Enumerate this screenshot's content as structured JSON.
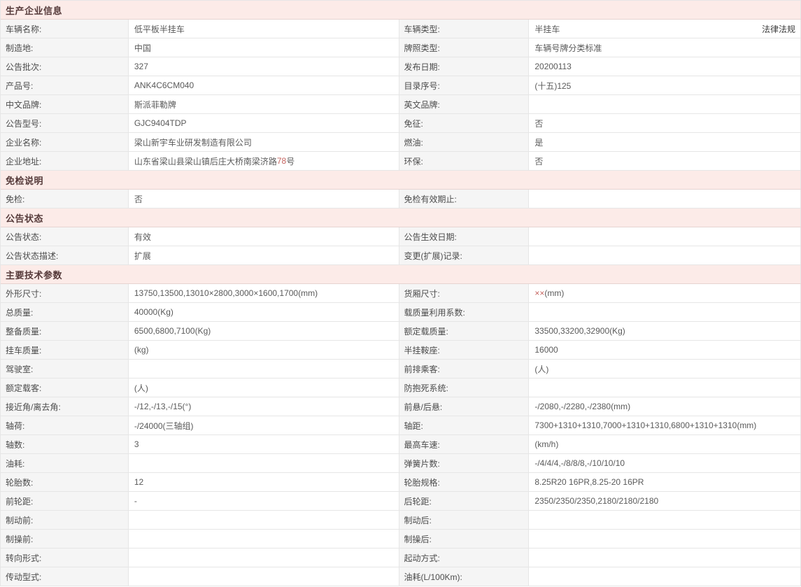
{
  "colors": {
    "section_header_bg": "#fcebe8",
    "section_header_text": "#553a3a",
    "label_cell_bg": "#f5f5f5",
    "value_cell_bg": "#ffffff",
    "highlight_text": "#c5635e",
    "border": "#e6e6e6"
  },
  "sections": [
    {
      "title": "生产企业信息",
      "rows": [
        {
          "left": {
            "label": "车辆名称:",
            "value": "低平板半挂车"
          },
          "right": {
            "label": "车辆类型:",
            "value": "半挂车"
          },
          "extra_link": "法律法规"
        },
        {
          "left": {
            "label": "制造地:",
            "value": "中国"
          },
          "right": {
            "label": "牌照类型:",
            "value": "车辆号牌分类标准"
          }
        },
        {
          "left": {
            "label": "公告批次:",
            "value": "327"
          },
          "right": {
            "label": "发布日期:",
            "value": "20200113"
          }
        },
        {
          "left": {
            "label": "产品号:",
            "value": "ANK4C6CM040"
          },
          "right": {
            "label": "目录序号:",
            "value": "(十五)125"
          }
        },
        {
          "left": {
            "label": "中文品牌:",
            "value": "斯派菲勒牌"
          },
          "right": {
            "label": "英文品牌:",
            "value": ""
          }
        },
        {
          "left": {
            "label": "公告型号:",
            "value": "GJC9404TDP"
          },
          "right": {
            "label": "免征:",
            "value": "否"
          }
        },
        {
          "left": {
            "label": "企业名称:",
            "value": "梁山新宇车业研发制造有限公司"
          },
          "right": {
            "label": "燃油:",
            "value": "是"
          }
        },
        {
          "left": {
            "label": "企业地址:",
            "parts": [
              {
                "t": "山东省梁山县梁山镇后庄大桥南梁济路",
                "red": false
              },
              {
                "t": "78",
                "red": true
              },
              {
                "t": "号",
                "red": false
              }
            ]
          },
          "right": {
            "label": "环保:",
            "value": "否"
          }
        }
      ]
    },
    {
      "title": "免检说明",
      "rows": [
        {
          "left": {
            "label": "免检:",
            "value": "否"
          },
          "right": {
            "label": "免检有效期止:",
            "value": ""
          }
        }
      ]
    },
    {
      "title": "公告状态",
      "rows": [
        {
          "left": {
            "label": "公告状态:",
            "value": "有效"
          },
          "right": {
            "label": "公告生效日期:",
            "value": ""
          }
        },
        {
          "left": {
            "label": "公告状态描述:",
            "value": "扩展"
          },
          "right": {
            "label": "变更(扩展)记录:",
            "value": ""
          }
        }
      ]
    },
    {
      "title": "主要技术参数",
      "rows": [
        {
          "left": {
            "label": "外形尺寸:",
            "value": "13750,13500,13010×2800,3000×1600,1700(mm)"
          },
          "right": {
            "label": "货厢尺寸:",
            "parts": [
              {
                "t": "××",
                "red": true
              },
              {
                "t": "(mm)",
                "red": false
              }
            ]
          }
        },
        {
          "left": {
            "label": "总质量:",
            "value": "40000(Kg)"
          },
          "right": {
            "label": "载质量利用系数:",
            "value": ""
          }
        },
        {
          "left": {
            "label": "整备质量:",
            "value": "6500,6800,7100(Kg)"
          },
          "right": {
            "label": "额定载质量:",
            "value": "33500,33200,32900(Kg)"
          }
        },
        {
          "left": {
            "label": "挂车质量:",
            "value": "(kg)"
          },
          "right": {
            "label": "半挂鞍座:",
            "value": "16000"
          }
        },
        {
          "left": {
            "label": "驾驶室:",
            "value": ""
          },
          "right": {
            "label": "前排乘客:",
            "value": "(人)"
          }
        },
        {
          "left": {
            "label": "额定载客:",
            "value": "(人)"
          },
          "right": {
            "label": "防抱死系统:",
            "value": ""
          }
        },
        {
          "left": {
            "label": "接近角/离去角:",
            "value": "-/12,-/13,-/15(°)"
          },
          "right": {
            "label": "前悬/后悬:",
            "value": "-/2080,-/2280,-/2380(mm)"
          }
        },
        {
          "left": {
            "label": "轴荷:",
            "value": "-/24000(三轴组)"
          },
          "right": {
            "label": "轴距:",
            "value": "7300+1310+1310,7000+1310+1310,6800+1310+1310(mm)"
          }
        },
        {
          "left": {
            "label": "轴数:",
            "value": "3"
          },
          "right": {
            "label": "最高车速:",
            "value": "(km/h)"
          }
        },
        {
          "left": {
            "label": "油耗:",
            "value": ""
          },
          "right": {
            "label": "弹簧片数:",
            "value": "-/4/4/4,-/8/8/8,-/10/10/10"
          }
        },
        {
          "left": {
            "label": "轮胎数:",
            "value": "12"
          },
          "right": {
            "label": "轮胎规格:",
            "value": "8.25R20 16PR,8.25-20 16PR"
          }
        },
        {
          "left": {
            "label": "前轮距:",
            "value": "-"
          },
          "right": {
            "label": "后轮距:",
            "value": "2350/2350/2350,2180/2180/2180"
          }
        },
        {
          "left": {
            "label": "制动前:",
            "value": ""
          },
          "right": {
            "label": "制动后:",
            "value": ""
          }
        },
        {
          "left": {
            "label": "制操前:",
            "value": ""
          },
          "right": {
            "label": "制操后:",
            "value": ""
          }
        },
        {
          "left": {
            "label": "转向形式:",
            "value": ""
          },
          "right": {
            "label": "起动方式:",
            "value": ""
          }
        },
        {
          "left": {
            "label": "传动型式:",
            "value": ""
          },
          "right": {
            "label": "油耗(L/100Km):",
            "value": ""
          }
        }
      ]
    }
  ]
}
